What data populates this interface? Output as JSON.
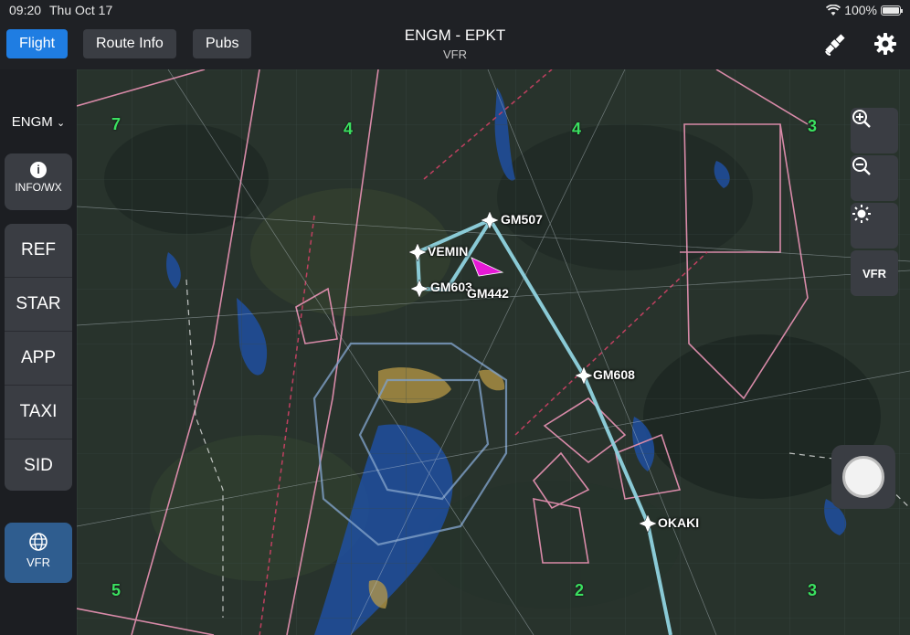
{
  "status": {
    "time": "09:20",
    "date": "Thu Oct 17",
    "battery": "100%",
    "battery_level": 1.0
  },
  "header": {
    "tabs": [
      {
        "label": "Flight",
        "active": true
      },
      {
        "label": "Route Info",
        "active": false
      },
      {
        "label": "Pubs",
        "active": false
      }
    ],
    "route": "ENGM - EPKT",
    "flight_rules": "VFR",
    "icons": [
      "satellite-icon",
      "gear-icon"
    ]
  },
  "sidebar": {
    "airport": "ENGM",
    "info_label": "INFO/WX",
    "procedures": [
      "REF",
      "STAR",
      "APP",
      "TAXI",
      "SID"
    ],
    "chart_type_label": "VFR"
  },
  "map": {
    "waypoints": [
      "GM507",
      "VEMIN",
      "GM603",
      "GM442",
      "GM608",
      "OKAKI"
    ],
    "controls": {
      "zoom_in": "zoom-in-icon",
      "zoom_out": "zoom-out-icon",
      "brightness": "brightness-icon",
      "chart_label": "VFR"
    },
    "colors": {
      "route": "#8fd3df",
      "ownship": "#e619d6",
      "airspace": "#d88aa8",
      "active_tab": "#1f7de2"
    }
  }
}
